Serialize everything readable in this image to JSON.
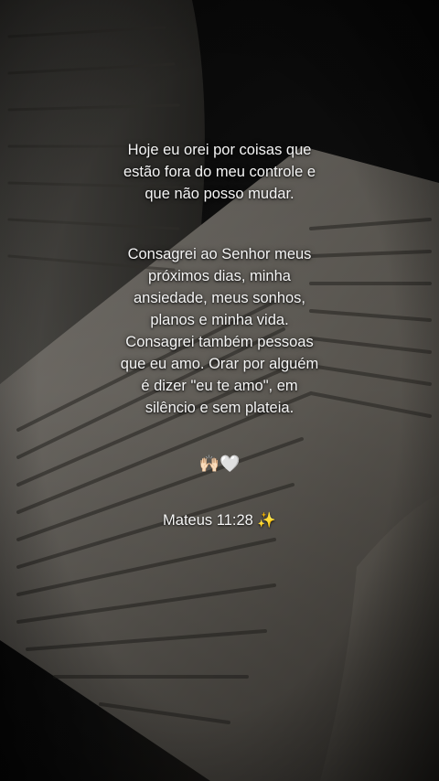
{
  "paragraph1": [
    "Hoje eu orei por coisas que",
    "estão fora do meu controle e",
    "que não posso mudar."
  ],
  "paragraph2": [
    "Consagrei ao Senhor meus",
    "próximos dias, minha",
    "ansiedade, meus sonhos,",
    "planos e minha vida.",
    "Consagrei também pessoas",
    "que eu amo. Orar por alguém",
    "é dizer \"eu te amo\", em",
    "silêncio e sem plateia."
  ],
  "emoji_line": "🙌🏻🤍",
  "reference": "Mateus 11:28",
  "reference_emoji": "✨"
}
